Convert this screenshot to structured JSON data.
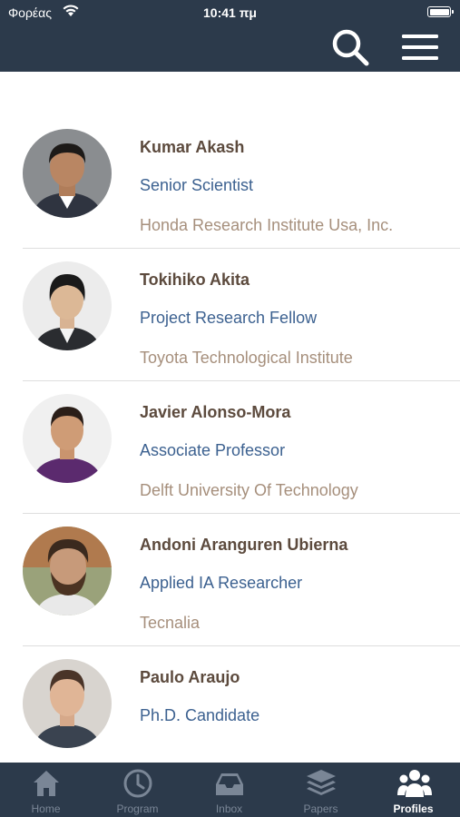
{
  "status_bar": {
    "carrier": "Φορέας",
    "time": "10:41 πμ"
  },
  "header": {
    "search_icon": "search-icon",
    "menu_icon": "menu-icon"
  },
  "profiles": [
    {
      "name": "Kumar Akash",
      "title": "Senior Scientist",
      "organization": "Honda Research Institute Usa, Inc."
    },
    {
      "name": "Tokihiko Akita",
      "title": "Project Research Fellow",
      "organization": "Toyota Technological Institute"
    },
    {
      "name": "Javier Alonso-Mora",
      "title": "Associate Professor",
      "organization": "Delft University Of Technology"
    },
    {
      "name": "Andoni Aranguren Ubierna",
      "title": "Applied IA Researcher",
      "organization": "Tecnalia"
    },
    {
      "name": "Paulo Araujo",
      "title": "Ph.D. Candidate",
      "organization": ""
    }
  ],
  "tabs": [
    {
      "label": "Home",
      "icon": "home-icon"
    },
    {
      "label": "Program",
      "icon": "clock-icon"
    },
    {
      "label": "Inbox",
      "icon": "inbox-icon"
    },
    {
      "label": "Papers",
      "icon": "layers-icon"
    },
    {
      "label": "Profiles",
      "icon": "people-icon",
      "active": true
    }
  ],
  "colors": {
    "header_bg": "#2c3a4b",
    "name": "#5c4a3d",
    "title": "#3c6190",
    "organization": "#a68f7c",
    "tab_inactive": "#7a8696",
    "tab_active": "#ffffff"
  }
}
